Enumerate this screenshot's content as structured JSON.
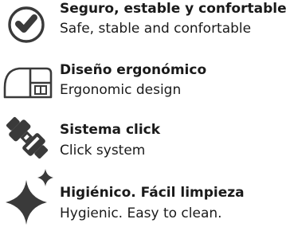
{
  "features": [
    {
      "icon": "check-circle-icon",
      "title": "Seguro, estable y confortable",
      "subtitle": "Safe, stable and confortable"
    },
    {
      "icon": "ergonomic-seat-icon",
      "title": "Diseño ergonómico",
      "subtitle": "Ergonomic design"
    },
    {
      "icon": "click-connector-icon",
      "title": "Sistema click",
      "subtitle": "Click system"
    },
    {
      "icon": "sparkle-icon",
      "title": "Higiénico. Fácil limpieza",
      "subtitle": "Hygienic. Easy to clean."
    }
  ],
  "colors": {
    "text": "#1a1a1a",
    "icon": "#3a3a3a",
    "background": "#ffffff"
  }
}
